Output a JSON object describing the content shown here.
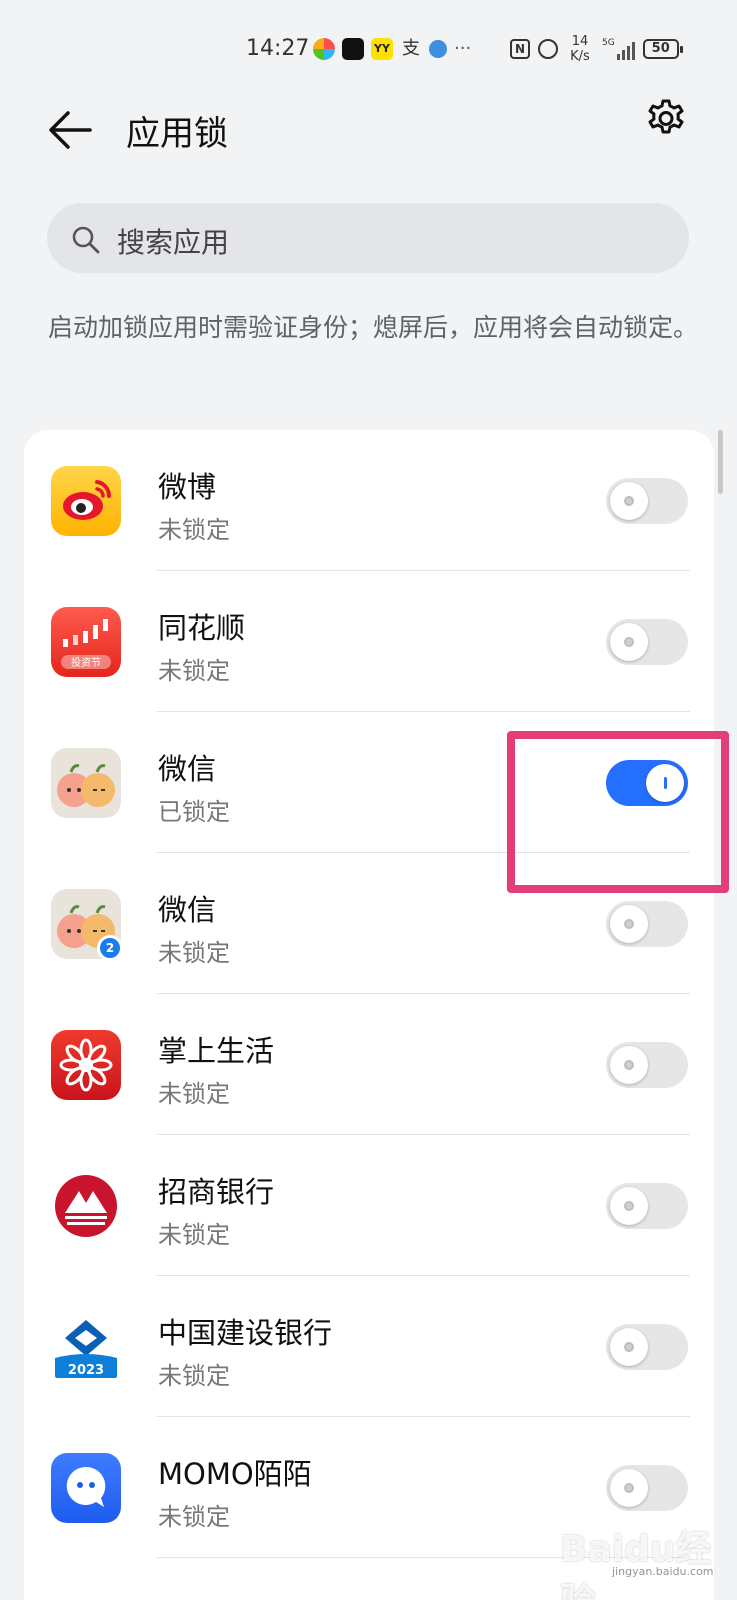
{
  "status_bar": {
    "time": "14:27",
    "speed_top": "14",
    "speed_bottom": "K/s",
    "network": "5G",
    "battery": "50",
    "nfc": "N",
    "more": "···"
  },
  "header": {
    "title": "应用锁"
  },
  "search": {
    "placeholder": "搜索应用"
  },
  "description": "启动加锁应用时需验证身份；熄屏后，应用将会自动锁定。",
  "apps": [
    {
      "name": "微博",
      "status": "未锁定",
      "locked": false,
      "icon": "weibo-icon"
    },
    {
      "name": "同花顺",
      "status": "未锁定",
      "locked": false,
      "icon": "tonghuashun-icon"
    },
    {
      "name": "微信",
      "status": "已锁定",
      "locked": true,
      "icon": "wechat-icon"
    },
    {
      "name": "微信",
      "status": "未锁定",
      "locked": false,
      "icon": "wechat-clone-icon"
    },
    {
      "name": "掌上生活",
      "status": "未锁定",
      "locked": false,
      "icon": "zhangshangshenghuo-icon"
    },
    {
      "name": "招商银行",
      "status": "未锁定",
      "locked": false,
      "icon": "cmb-icon"
    },
    {
      "name": "中国建设银行",
      "status": "未锁定",
      "locked": false,
      "icon": "ccb-icon"
    },
    {
      "name": "MOMO陌陌",
      "status": "未锁定",
      "locked": false,
      "icon": "momo-icon"
    }
  ],
  "colors": {
    "accent": "#256fff",
    "highlight": "#e23e7a",
    "background": "#f1f3f5"
  },
  "ccb_badge": "2023",
  "tonghuashun_badge": "投资节",
  "clone_badge": "2",
  "watermark": "Baidu经验",
  "watermark_sub": "jingyan.baidu.com"
}
